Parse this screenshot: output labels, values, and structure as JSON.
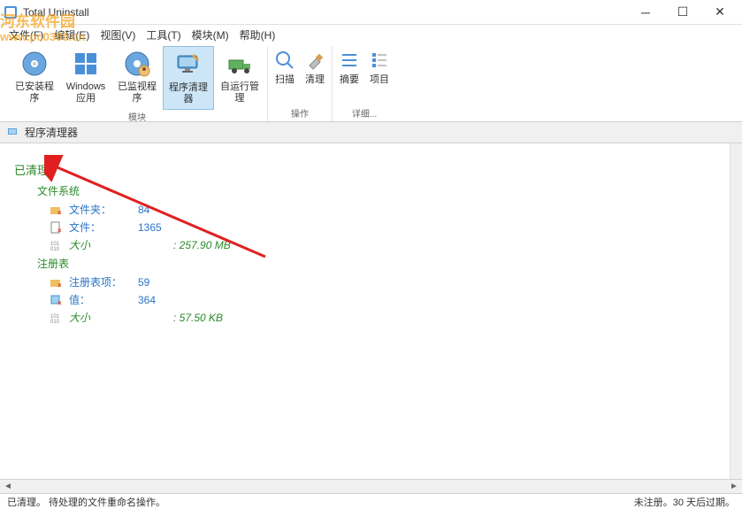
{
  "app": {
    "title": "Total Uninstall",
    "watermark_line1": "河东软件园",
    "watermark_line2": "www.pc0359.cn"
  },
  "menu": {
    "file": "文件(F)",
    "edit": "编辑(E)",
    "view": "视图(V)",
    "tools": "工具(T)",
    "modules": "模块(M)",
    "help": "帮助(H)"
  },
  "ribbon": {
    "installed_programs": "已安装程序",
    "windows_apps": "Windows 应用",
    "monitored_programs": "已监视程序",
    "program_cleaner": "程序清理器",
    "autorun_manager": "自运行管理",
    "scan": "扫描",
    "clean": "清理",
    "summary": "摘要",
    "items": "项目",
    "detailed": "详细...",
    "group_modules": "模块",
    "group_operations": "操作"
  },
  "subheader": {
    "title": "程序清理器"
  },
  "results": {
    "cleaned_label": "已清理",
    "filesystem_label": "文件系统",
    "folders_label": "文件夹：",
    "folders_value": "84",
    "files_label": "文件：",
    "files_value": "1365",
    "size_label": "大小",
    "fs_size_value": ": 257.90 MB",
    "registry_label": "注册表",
    "regitems_label": "注册表项：",
    "regitems_value": "59",
    "values_label": "值：",
    "values_value": "364",
    "reg_size_value": ": 57.50 KB"
  },
  "status": {
    "left": "已清理。  待处理的文件重命名操作。",
    "right": "未注册。30 天后过期。"
  }
}
